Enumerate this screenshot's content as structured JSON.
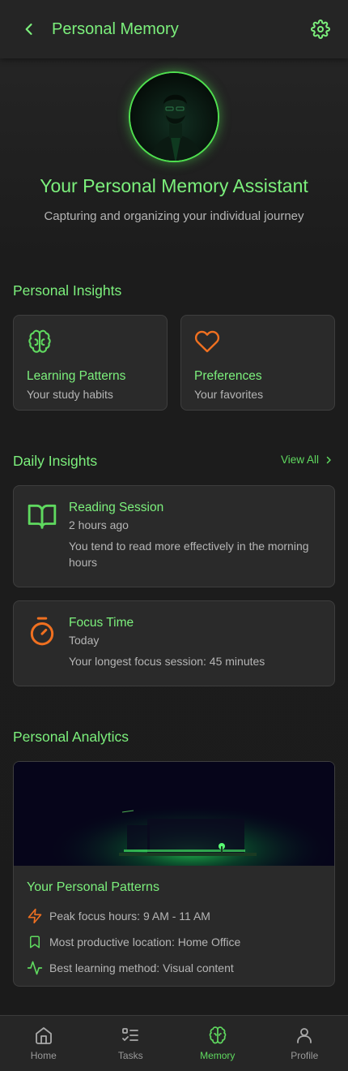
{
  "header": {
    "title": "Personal Memory",
    "back_icon": "chevron-left-icon",
    "settings_icon": "gear-icon"
  },
  "hero": {
    "title": "Your Personal Memory Assistant",
    "subtitle": "Capturing and organizing your individual journey"
  },
  "personal_insights": {
    "title": "Personal Insights",
    "cards": [
      {
        "icon": "brain-icon",
        "title": "Learning Patterns",
        "subtitle": "Your study habits"
      },
      {
        "icon": "heart-icon",
        "title": "Preferences",
        "subtitle": "Your favorites"
      }
    ]
  },
  "daily_insights": {
    "title": "Daily Insights",
    "view_all": "View All",
    "items": [
      {
        "icon": "book-open-icon",
        "title": "Reading Session",
        "time": "2 hours ago",
        "description": "You tend to read more effectively in the morning hours"
      },
      {
        "icon": "timer-icon",
        "title": "Focus Time",
        "time": "Today",
        "description": "Your longest focus session: 45 minutes"
      }
    ]
  },
  "analytics": {
    "title": "Personal Analytics",
    "card_title": "Your Personal Patterns",
    "patterns": [
      {
        "icon": "lightning-icon",
        "text": "Peak focus hours: 9 AM - 11 AM"
      },
      {
        "icon": "bookmark-icon",
        "text": "Most productive location: Home Office"
      },
      {
        "icon": "activity-icon",
        "text": "Best learning method: Visual content"
      }
    ]
  },
  "nav": {
    "items": [
      {
        "icon": "home-icon",
        "label": "Home",
        "active": false
      },
      {
        "icon": "tasks-icon",
        "label": "Tasks",
        "active": false
      },
      {
        "icon": "brain-icon",
        "label": "Memory",
        "active": true
      },
      {
        "icon": "user-icon",
        "label": "Profile",
        "active": false
      }
    ]
  },
  "colors": {
    "accent_green": "#7cf07c",
    "accent_orange": "#f07020",
    "background": "#1b1b1b",
    "card": "#2a2a2a"
  }
}
